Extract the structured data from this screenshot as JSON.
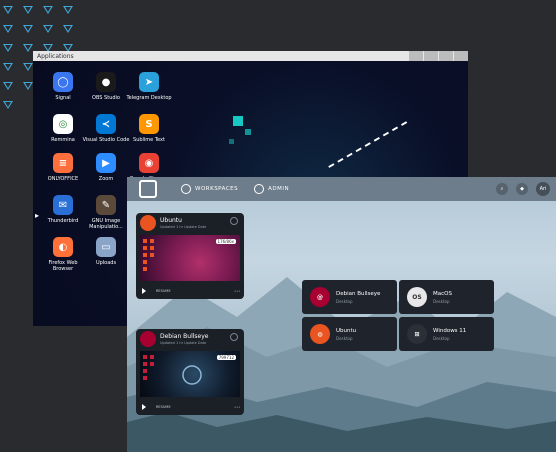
{
  "applications_window": {
    "title": "Applications",
    "icons": [
      {
        "label": "Signal",
        "icon": "signal-icon",
        "color": "#3a76f0",
        "glyph": "◯"
      },
      {
        "label": "OBS Studio",
        "icon": "obs-icon",
        "color": "#1a1a1a",
        "glyph": "●"
      },
      {
        "label": "Telegram Desktop",
        "icon": "telegram-icon",
        "color": "#2aa1da",
        "glyph": "➤"
      },
      {
        "label": "Remmina",
        "icon": "remmina-icon",
        "color": "#ffffff",
        "glyph": "◎"
      },
      {
        "label": "Visual Studio Code",
        "icon": "vscode-icon",
        "color": "#0078d4",
        "glyph": "≺"
      },
      {
        "label": "Sublime Text",
        "icon": "sublime-icon",
        "color": "#ff9800",
        "glyph": "S"
      },
      {
        "label": "ONLYOFFICE",
        "icon": "onlyoffice-icon",
        "color": "#ff6f3d",
        "glyph": "≡"
      },
      {
        "label": "Zoom",
        "icon": "zoom-icon",
        "color": "#2d8cff",
        "glyph": "▶"
      },
      {
        "label": "Google Chrome",
        "icon": "chrome-icon",
        "color": "#e94235",
        "glyph": "◉"
      },
      {
        "label": "Thunderbird",
        "icon": "thunderbird-icon",
        "color": "#2a6fd6",
        "glyph": "✉"
      },
      {
        "label": "GNU Image Manipulatio...",
        "icon": "gimp-icon",
        "color": "#5b4a3a",
        "glyph": "✎"
      },
      {
        "label": "Downloads",
        "icon": "downloads-folder-icon",
        "color": "#8aa4c8",
        "glyph": "▭"
      },
      {
        "label": "Firefox Web Browser",
        "icon": "firefox-icon",
        "color": "#ff7139",
        "glyph": "◐"
      },
      {
        "label": "Uploads",
        "icon": "uploads-folder-icon",
        "color": "#8aa4c8",
        "glyph": "▭"
      }
    ]
  },
  "kasm": {
    "nav": {
      "workspaces": "WORKSPACES",
      "admin": "ADMIN"
    },
    "avatar_text": "Ari",
    "sessions": [
      {
        "title": "Ubuntu",
        "subtitle": "Updated 1 hr    Update Date",
        "badge": "176/86x",
        "footer": "RESUME"
      },
      {
        "title": "Debian Bullseye",
        "subtitle": "Updated 1 hr    Update Date",
        "badge": "799712",
        "footer": "RESUME"
      }
    ],
    "workspaces": [
      {
        "name": "Debian Bullseye",
        "desc": "Desktop",
        "icon": "debian-icon",
        "color": "#a80030",
        "glyph": "@"
      },
      {
        "name": "MacOS",
        "desc": "Desktop",
        "icon": "macos-icon",
        "color": "#e8e8e8",
        "glyph": "OS"
      },
      {
        "name": "Ubuntu",
        "desc": "Desktop",
        "icon": "ubuntu-icon",
        "color": "#e95420",
        "glyph": "◍"
      },
      {
        "name": "Windows 11",
        "desc": "Desktop",
        "icon": "windows-icon",
        "color": "#2a2f38",
        "glyph": "⊞"
      }
    ]
  }
}
